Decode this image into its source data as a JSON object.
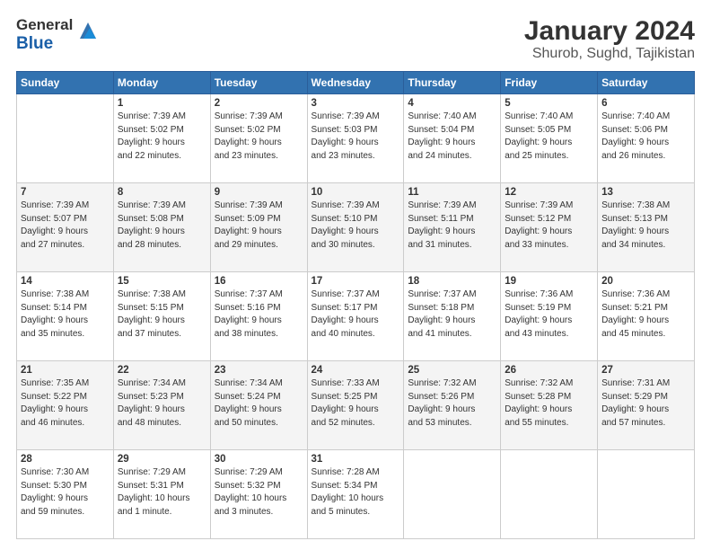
{
  "logo": {
    "general": "General",
    "blue": "Blue"
  },
  "title": "January 2024",
  "subtitle": "Shurob, Sughd, Tajikistan",
  "days_header": [
    "Sunday",
    "Monday",
    "Tuesday",
    "Wednesday",
    "Thursday",
    "Friday",
    "Saturday"
  ],
  "weeks": [
    [
      {
        "day": "",
        "info": ""
      },
      {
        "day": "1",
        "info": "Sunrise: 7:39 AM\nSunset: 5:02 PM\nDaylight: 9 hours\nand 22 minutes."
      },
      {
        "day": "2",
        "info": "Sunrise: 7:39 AM\nSunset: 5:02 PM\nDaylight: 9 hours\nand 23 minutes."
      },
      {
        "day": "3",
        "info": "Sunrise: 7:39 AM\nSunset: 5:03 PM\nDaylight: 9 hours\nand 23 minutes."
      },
      {
        "day": "4",
        "info": "Sunrise: 7:40 AM\nSunset: 5:04 PM\nDaylight: 9 hours\nand 24 minutes."
      },
      {
        "day": "5",
        "info": "Sunrise: 7:40 AM\nSunset: 5:05 PM\nDaylight: 9 hours\nand 25 minutes."
      },
      {
        "day": "6",
        "info": "Sunrise: 7:40 AM\nSunset: 5:06 PM\nDaylight: 9 hours\nand 26 minutes."
      }
    ],
    [
      {
        "day": "7",
        "info": "Sunrise: 7:39 AM\nSunset: 5:07 PM\nDaylight: 9 hours\nand 27 minutes."
      },
      {
        "day": "8",
        "info": "Sunrise: 7:39 AM\nSunset: 5:08 PM\nDaylight: 9 hours\nand 28 minutes."
      },
      {
        "day": "9",
        "info": "Sunrise: 7:39 AM\nSunset: 5:09 PM\nDaylight: 9 hours\nand 29 minutes."
      },
      {
        "day": "10",
        "info": "Sunrise: 7:39 AM\nSunset: 5:10 PM\nDaylight: 9 hours\nand 30 minutes."
      },
      {
        "day": "11",
        "info": "Sunrise: 7:39 AM\nSunset: 5:11 PM\nDaylight: 9 hours\nand 31 minutes."
      },
      {
        "day": "12",
        "info": "Sunrise: 7:39 AM\nSunset: 5:12 PM\nDaylight: 9 hours\nand 33 minutes."
      },
      {
        "day": "13",
        "info": "Sunrise: 7:38 AM\nSunset: 5:13 PM\nDaylight: 9 hours\nand 34 minutes."
      }
    ],
    [
      {
        "day": "14",
        "info": "Sunrise: 7:38 AM\nSunset: 5:14 PM\nDaylight: 9 hours\nand 35 minutes."
      },
      {
        "day": "15",
        "info": "Sunrise: 7:38 AM\nSunset: 5:15 PM\nDaylight: 9 hours\nand 37 minutes."
      },
      {
        "day": "16",
        "info": "Sunrise: 7:37 AM\nSunset: 5:16 PM\nDaylight: 9 hours\nand 38 minutes."
      },
      {
        "day": "17",
        "info": "Sunrise: 7:37 AM\nSunset: 5:17 PM\nDaylight: 9 hours\nand 40 minutes."
      },
      {
        "day": "18",
        "info": "Sunrise: 7:37 AM\nSunset: 5:18 PM\nDaylight: 9 hours\nand 41 minutes."
      },
      {
        "day": "19",
        "info": "Sunrise: 7:36 AM\nSunset: 5:19 PM\nDaylight: 9 hours\nand 43 minutes."
      },
      {
        "day": "20",
        "info": "Sunrise: 7:36 AM\nSunset: 5:21 PM\nDaylight: 9 hours\nand 45 minutes."
      }
    ],
    [
      {
        "day": "21",
        "info": "Sunrise: 7:35 AM\nSunset: 5:22 PM\nDaylight: 9 hours\nand 46 minutes."
      },
      {
        "day": "22",
        "info": "Sunrise: 7:34 AM\nSunset: 5:23 PM\nDaylight: 9 hours\nand 48 minutes."
      },
      {
        "day": "23",
        "info": "Sunrise: 7:34 AM\nSunset: 5:24 PM\nDaylight: 9 hours\nand 50 minutes."
      },
      {
        "day": "24",
        "info": "Sunrise: 7:33 AM\nSunset: 5:25 PM\nDaylight: 9 hours\nand 52 minutes."
      },
      {
        "day": "25",
        "info": "Sunrise: 7:32 AM\nSunset: 5:26 PM\nDaylight: 9 hours\nand 53 minutes."
      },
      {
        "day": "26",
        "info": "Sunrise: 7:32 AM\nSunset: 5:28 PM\nDaylight: 9 hours\nand 55 minutes."
      },
      {
        "day": "27",
        "info": "Sunrise: 7:31 AM\nSunset: 5:29 PM\nDaylight: 9 hours\nand 57 minutes."
      }
    ],
    [
      {
        "day": "28",
        "info": "Sunrise: 7:30 AM\nSunset: 5:30 PM\nDaylight: 9 hours\nand 59 minutes."
      },
      {
        "day": "29",
        "info": "Sunrise: 7:29 AM\nSunset: 5:31 PM\nDaylight: 10 hours\nand 1 minute."
      },
      {
        "day": "30",
        "info": "Sunrise: 7:29 AM\nSunset: 5:32 PM\nDaylight: 10 hours\nand 3 minutes."
      },
      {
        "day": "31",
        "info": "Sunrise: 7:28 AM\nSunset: 5:34 PM\nDaylight: 10 hours\nand 5 minutes."
      },
      {
        "day": "",
        "info": ""
      },
      {
        "day": "",
        "info": ""
      },
      {
        "day": "",
        "info": ""
      }
    ]
  ]
}
